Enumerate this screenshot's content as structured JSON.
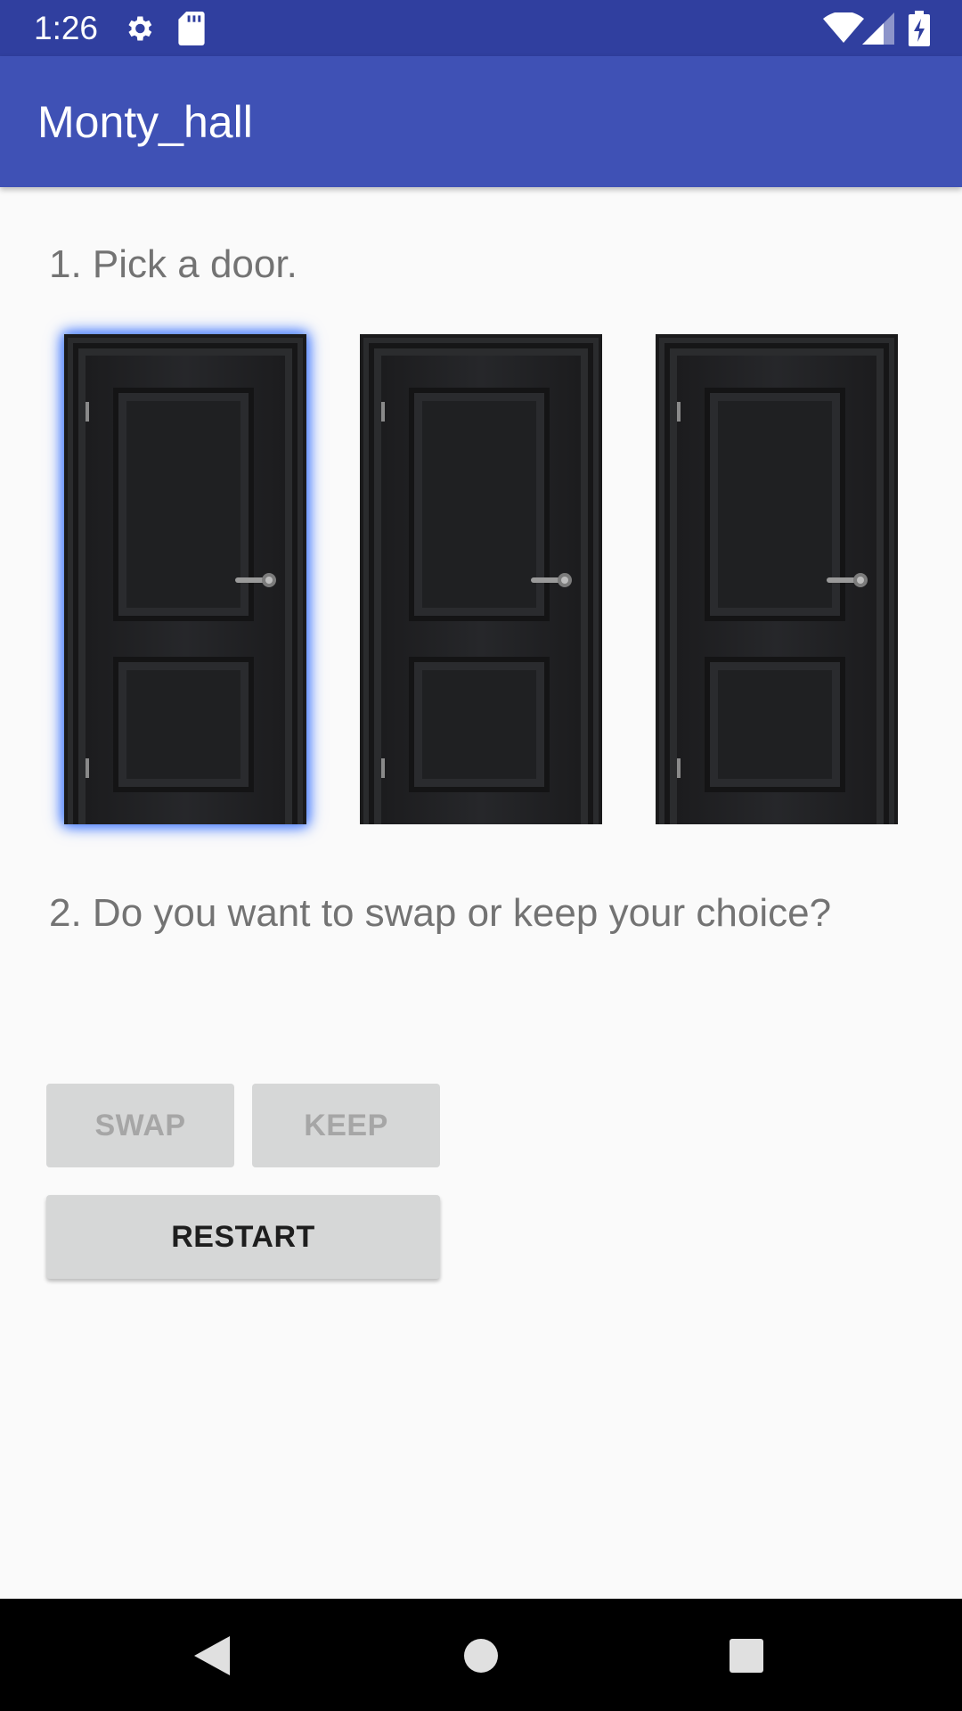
{
  "status_bar": {
    "time": "1:26",
    "icons": [
      "gear-icon",
      "sd-card-icon",
      "wifi-icon",
      "cell-signal-icon",
      "battery-charging-icon"
    ]
  },
  "app_bar": {
    "title": "Monty_hall"
  },
  "main": {
    "step1": "1. Pick a door.",
    "doors": [
      {
        "name": "door-1",
        "selected": true
      },
      {
        "name": "door-2",
        "selected": false
      },
      {
        "name": "door-3",
        "selected": false
      }
    ],
    "step2": "2. Do you want to swap or keep your choice?",
    "buttons": {
      "swap": "SWAP",
      "keep": "KEEP",
      "restart": "RESTART"
    },
    "swap_enabled": false,
    "keep_enabled": false
  },
  "colors": {
    "primary": "#3f51b5",
    "primary_dark": "#303f9f",
    "background": "#fafafa",
    "selection_glow": "#4a7dff",
    "door": "#1f2022"
  },
  "nav_bar": {
    "icons": [
      "back-icon",
      "home-icon",
      "recents-icon"
    ]
  }
}
